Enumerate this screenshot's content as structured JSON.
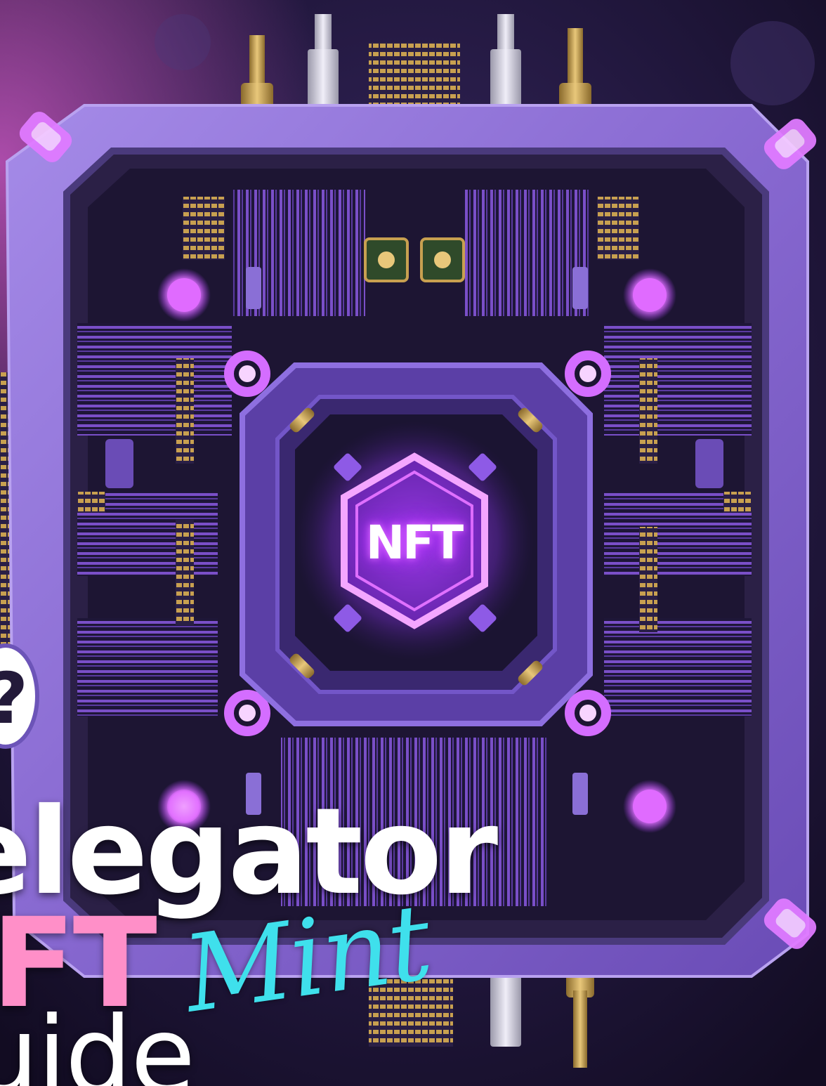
{
  "chip": {
    "label": "NFT"
  },
  "badge": {
    "text": "?"
  },
  "title": {
    "line1": "elegator",
    "line2": "IFT",
    "script": "Mint",
    "line3": "uide"
  },
  "colors": {
    "background": "#1a1230",
    "frame": "#8a6fd6",
    "glow": "#e070ff",
    "title_pink": "#ff8fc8",
    "script_cyan": "#3fe0ec"
  }
}
